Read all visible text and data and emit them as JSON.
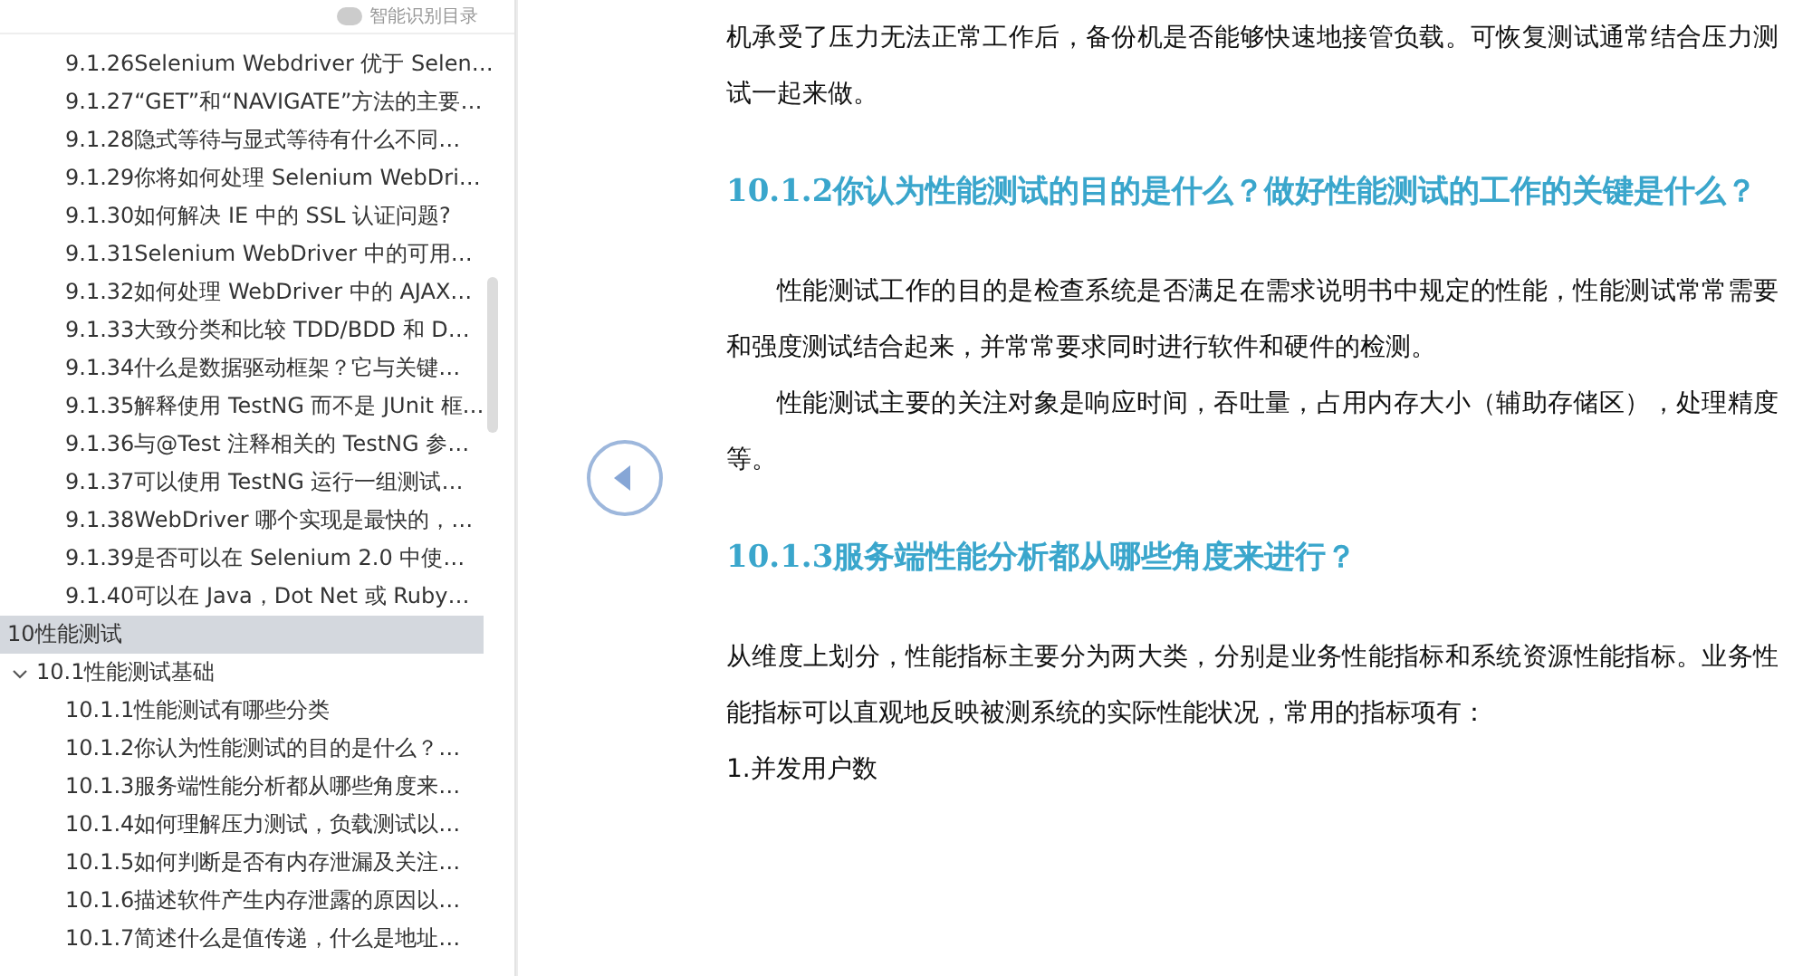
{
  "sidebar": {
    "smart_toc_toggle": {
      "label": "智能识别目录",
      "on": false
    },
    "continued_items": [
      {
        "label": "9.1.26Selenium Webdriver 优于 Selen…",
        "selected": false
      },
      {
        "label": "9.1.27“GET”和“NAVIGATE”方法的主要…",
        "selected": false
      },
      {
        "label": "9.1.28隐式等待与显式等待有什么不同…",
        "selected": false
      },
      {
        "label": "9.1.29你将如何处理 Selenium WebDri…",
        "selected": false
      },
      {
        "label": "9.1.30如何解决 IE 中的 SSL 认证问题?",
        "selected": false
      },
      {
        "label": "9.1.31Selenium WebDriver 中的可用…",
        "selected": false
      },
      {
        "label": "9.1.32如何处理 WebDriver 中的 AJAX…",
        "selected": false
      },
      {
        "label": "9.1.33大致分类和比较 TDD/BDD 和 D…",
        "selected": false
      },
      {
        "label": "9.1.34什么是数据驱动框架？它与关键…",
        "selected": false
      },
      {
        "label": "9.1.35解释使用 TestNG 而不是 JUnit 框…",
        "selected": false
      },
      {
        "label": "9.1.36与@Test 注释相关的 TestNG 参…",
        "selected": false
      },
      {
        "label": "9.1.37可以使用 TestNG 运行一组测试…",
        "selected": false
      },
      {
        "label": "9.1.38WebDriver 哪个实现是最快的，…",
        "selected": false
      },
      {
        "label": "9.1.39是否可以在 Selenium 2.0 中使…",
        "selected": false
      },
      {
        "label": "9.1.40可以在 Java，Dot Net 或 Ruby…",
        "selected": false
      }
    ],
    "sections": [
      {
        "label": "10性能测试",
        "selected": true,
        "children": [
          {
            "label": "10.1性能测试基础",
            "selected": false,
            "expanded": true,
            "children": [
              {
                "label": "10.1.1性能测试有哪些分类",
                "selected": false
              },
              {
                "label": "10.1.2你认为性能测试的目的是什么？…",
                "selected": false
              },
              {
                "label": "10.1.3服务端性能分析都从哪些角度来…",
                "selected": false
              },
              {
                "label": "10.1.4如何理解压力测试，负载测试以…",
                "selected": false
              },
              {
                "label": "10.1.5如何判断是否有内存泄漏及关注…",
                "selected": false
              },
              {
                "label": "10.1.6描述软件产生内存泄露的原因以…",
                "selected": false
              },
              {
                "label": "10.1.7简述什么是值传递，什么是地址…",
                "selected": false
              }
            ]
          }
        ]
      }
    ]
  },
  "document": {
    "blocks": [
      {
        "kind": "paragraph",
        "indent": false,
        "text": "机承受了压力无法正常工作后，备份机是否能够快速地接管负载。可恢复测试通常结合压力测试一起来做。"
      },
      {
        "kind": "heading",
        "text": "10.1.2你认为性能测试的目的是什么？做好性能测试的工作的关键是什么？"
      },
      {
        "kind": "paragraph",
        "indent": true,
        "text": "性能测试工作的目的是检查系统是否满足在需求说明书中规定的性能，性能测试常常需要和强度测试结合起来，并常常要求同时进行软件和硬件的检测。"
      },
      {
        "kind": "paragraph",
        "indent": true,
        "text": "性能测试主要的关注对象是响应时间，吞吐量，占用内存大小（辅助存储区），处理精度等。"
      },
      {
        "kind": "heading",
        "text": "10.1.3服务端性能分析都从哪些角度来进行？"
      },
      {
        "kind": "paragraph",
        "indent": false,
        "text": "从维度上划分，性能指标主要分为两大类，分别是业务性能指标和系统资源性能指标。业务性能指标可以直观地反映被测系统的实际性能状况，常用的指标项有："
      },
      {
        "kind": "paragraph",
        "indent": false,
        "text": "1.并发用户数"
      }
    ]
  }
}
